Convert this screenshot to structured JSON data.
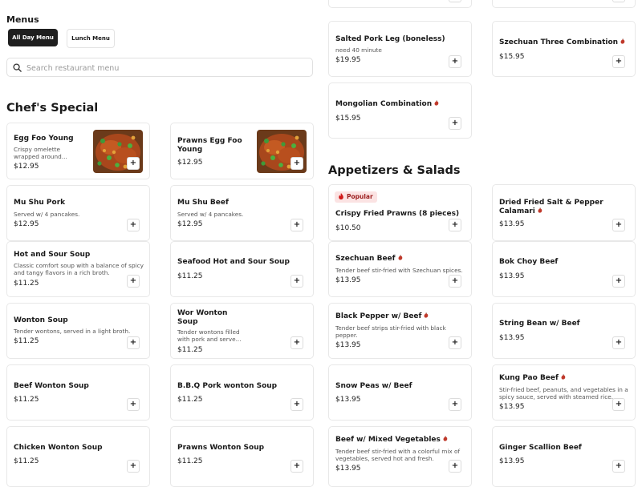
{
  "colors": {
    "accent": "#1f1f1f",
    "spicy": "#c0392b",
    "popular_bg": "#fbe3e3",
    "popular_text": "#9c1f1f"
  },
  "menus": {
    "title": "Menus",
    "tabs": [
      {
        "label": "All Day Menu",
        "active": true
      },
      {
        "label": "Lunch Menu",
        "active": false
      }
    ]
  },
  "search": {
    "placeholder": "Search restaurant menu",
    "value": "",
    "icon": "search-icon"
  },
  "icons": {
    "add": "+",
    "spicy": "pepper-icon",
    "popular": "fire-icon"
  },
  "sections": {
    "chefs_special": {
      "title": "Chef's Special",
      "items": [
        {
          "name": "Egg Foo Young",
          "description": "Crispy omelette wrapped around...",
          "price": "$12.95",
          "has_image": true
        },
        {
          "name": "Prawns Egg Foo Young",
          "description": "",
          "price": "$12.95",
          "has_image": true
        },
        {
          "name": "Mu Shu Pork",
          "description": "Served w/ 4 pancakes.",
          "price": "$12.95"
        },
        {
          "name": "Mu Shu Beef",
          "description": "Served w/ 4 pancakes.",
          "price": "$12.95"
        },
        {
          "name": "Hot and Sour Soup",
          "description": "Classic comfort soup with a balance of spicy and tangy flavors in a rich broth.",
          "price": "$11.25"
        },
        {
          "name": "Seafood Hot and Sour Soup",
          "description": "",
          "price": "$11.25"
        },
        {
          "name": "Wonton Soup",
          "description": "Tender wontons, served in a light broth.",
          "price": "$11.25"
        },
        {
          "name": "Wor Wonton Soup",
          "description": "Tender wontons filled with pork and serve...",
          "price": "$11.25"
        },
        {
          "name": "Beef Wonton Soup",
          "description": "",
          "price": "$11.25"
        },
        {
          "name": "B.B.Q Pork wonton Soup",
          "description": "",
          "price": "$11.25"
        },
        {
          "name": "Chicken Wonton Soup",
          "description": "",
          "price": "$11.25"
        },
        {
          "name": "Prawns Wonton Soup",
          "description": "",
          "price": "$11.25"
        }
      ]
    },
    "combinations": {
      "items": [
        {
          "name": "Salted Pork Leg (boneless)",
          "description": "need 40 minute",
          "price": "$19.95",
          "spicy": false
        },
        {
          "name": "Szechuan Three Combination",
          "description": "",
          "price": "$15.95",
          "spicy": true
        },
        {
          "name": "Mongolian Combination",
          "description": "",
          "price": "$15.95",
          "spicy": true
        }
      ]
    },
    "appetizers": {
      "title": "Appetizers & Salads",
      "badge": "Popular",
      "items": [
        {
          "name": "Crispy Fried Prawns (8 pieces)",
          "description": "",
          "price": "$10.50",
          "popular": true
        },
        {
          "name": "Dried Fried Salt & Pepper Calamari",
          "description": "",
          "price": "$13.95",
          "spicy": true
        },
        {
          "name": "Szechuan Beef",
          "description": "Tender beef stir-fried with Szechuan spices.",
          "price": "$13.95",
          "spicy": true
        },
        {
          "name": "Bok Choy Beef",
          "description": "",
          "price": "$13.95"
        },
        {
          "name": "Black Pepper w/ Beef",
          "description": "Tender beef strips stir-fried with black pepper.",
          "price": "$13.95",
          "spicy": true
        },
        {
          "name": "String Bean w/ Beef",
          "description": "",
          "price": "$13.95"
        },
        {
          "name": "Snow Peas w/ Beef",
          "description": "",
          "price": "$13.95"
        },
        {
          "name": "Kung Pao Beef",
          "description": "Stir-fried beef, peanuts, and vegetables in a spicy sauce, served with steamed rice.",
          "price": "$13.95",
          "spicy": true
        },
        {
          "name": "Beef w/ Mixed Vegetables",
          "description": "Tender beef stir-fried with a colorful mix of vegetables, served hot and fresh.",
          "price": "$13.95",
          "spicy": true
        },
        {
          "name": "Ginger Scallion Beef",
          "description": "",
          "price": "$13.95"
        }
      ]
    }
  }
}
